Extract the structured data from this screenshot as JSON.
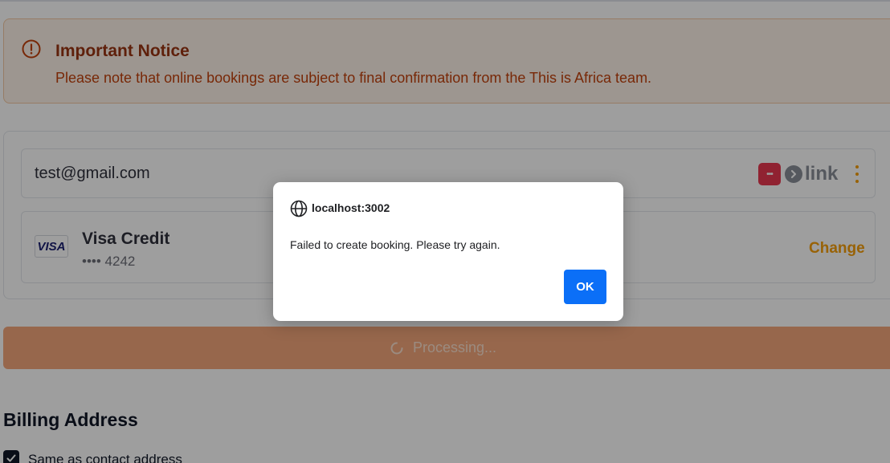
{
  "notice": {
    "title": "Important Notice",
    "text": "Please note that online bookings are subject to final confirmation from the This is Africa team.",
    "icon": "alert-circle-icon",
    "color_title": "#9a3412",
    "color_bg": "#fdf2e9"
  },
  "payment": {
    "email": "test@gmail.com",
    "link_badge": "•••",
    "link_word": "link",
    "card_brand": "VISA",
    "card_name": "Visa Credit",
    "card_number": "•••• 4242",
    "change_label": "Change",
    "accent_color": "#f59e0b"
  },
  "submit": {
    "label": "Processing...",
    "color": "#f4a77b"
  },
  "billing": {
    "title": "Billing Address",
    "same_as_contact_label": "Same as contact address",
    "same_as_contact_checked": true
  },
  "dialog": {
    "origin": "localhost:3002",
    "message": "Failed to create booking. Please try again.",
    "ok_label": "OK",
    "ok_color": "#0b6ff7"
  }
}
